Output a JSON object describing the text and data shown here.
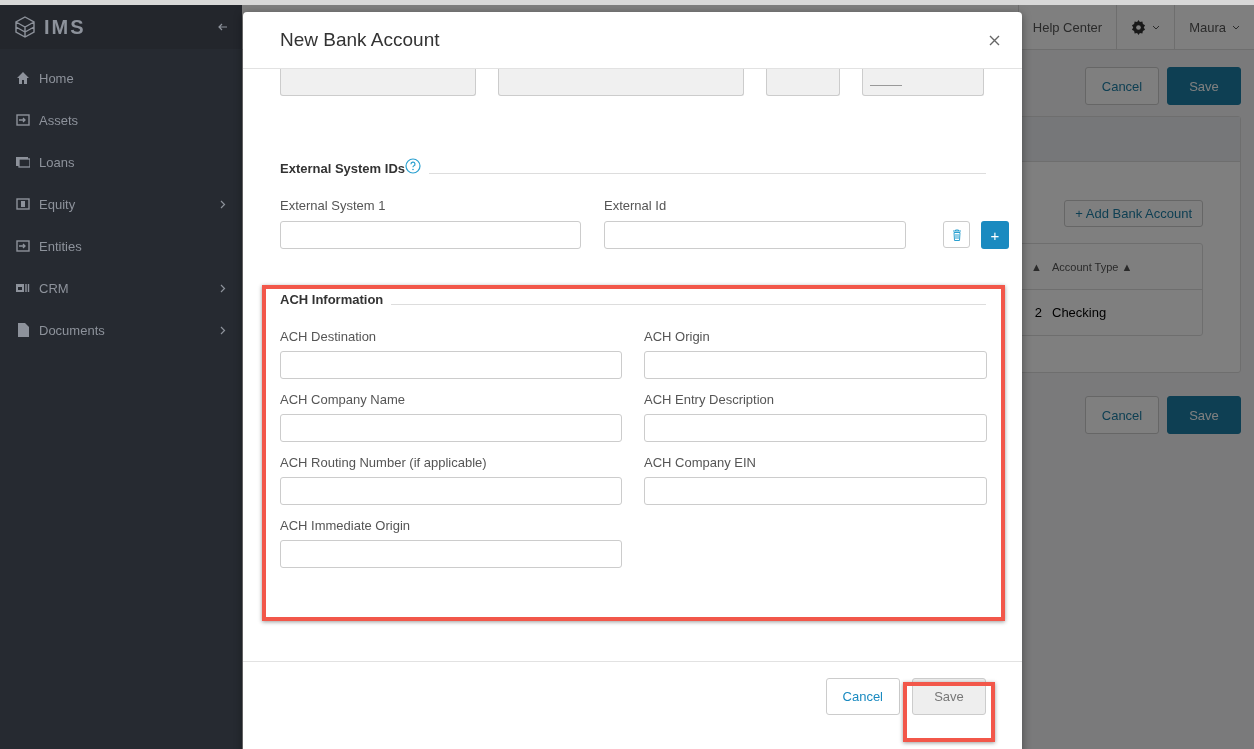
{
  "sidebar": {
    "logo": "IMS",
    "items": [
      {
        "label": "Home",
        "expandable": false
      },
      {
        "label": "Assets",
        "expandable": false
      },
      {
        "label": "Loans",
        "expandable": false
      },
      {
        "label": "Equity",
        "expandable": true
      },
      {
        "label": "Entities",
        "expandable": false
      },
      {
        "label": "CRM",
        "expandable": true
      },
      {
        "label": "Documents",
        "expandable": true
      }
    ]
  },
  "topbar": {
    "help": "Help Center",
    "user": "Maura"
  },
  "page": {
    "top_buttons": [
      {
        "label": "Cancel",
        "kind": "secondary"
      },
      {
        "label": "Save",
        "kind": "primary"
      }
    ],
    "add_button": "+ Add Bank Account",
    "table": {
      "columns": [
        "▲",
        "Account Type ▲"
      ],
      "rows": [
        [
          "2",
          "Checking"
        ]
      ]
    },
    "bottom_buttons": [
      {
        "label": "Cancel",
        "kind": "secondary"
      },
      {
        "label": "Save",
        "kind": "primary"
      }
    ]
  },
  "modal": {
    "title": "New Bank Account",
    "top_fields": [
      {
        "disabled": true,
        "kind": "plain"
      },
      {
        "disabled": true,
        "kind": "plain"
      },
      {
        "disabled": true,
        "kind": "plain"
      },
      {
        "disabled": true,
        "kind": "blank"
      }
    ],
    "external": {
      "title": "External System IDs",
      "fields": [
        {
          "label": "External System 1"
        },
        {
          "label": "External Id"
        }
      ],
      "add": "+"
    },
    "ach": {
      "title": "ACH Information",
      "fields": [
        {
          "label": "ACH Destination"
        },
        {
          "label": "ACH Origin"
        },
        {
          "label": "ACH Company Name"
        },
        {
          "label": "ACH Entry Description"
        },
        {
          "label": "ACH Routing Number (if applicable)"
        },
        {
          "label": "ACH Company EIN"
        },
        {
          "label": "ACH Immediate Origin"
        }
      ]
    },
    "footer": [
      {
        "label": "Cancel",
        "kind": "link"
      },
      {
        "label": "Save",
        "kind": "disabled"
      }
    ]
  }
}
